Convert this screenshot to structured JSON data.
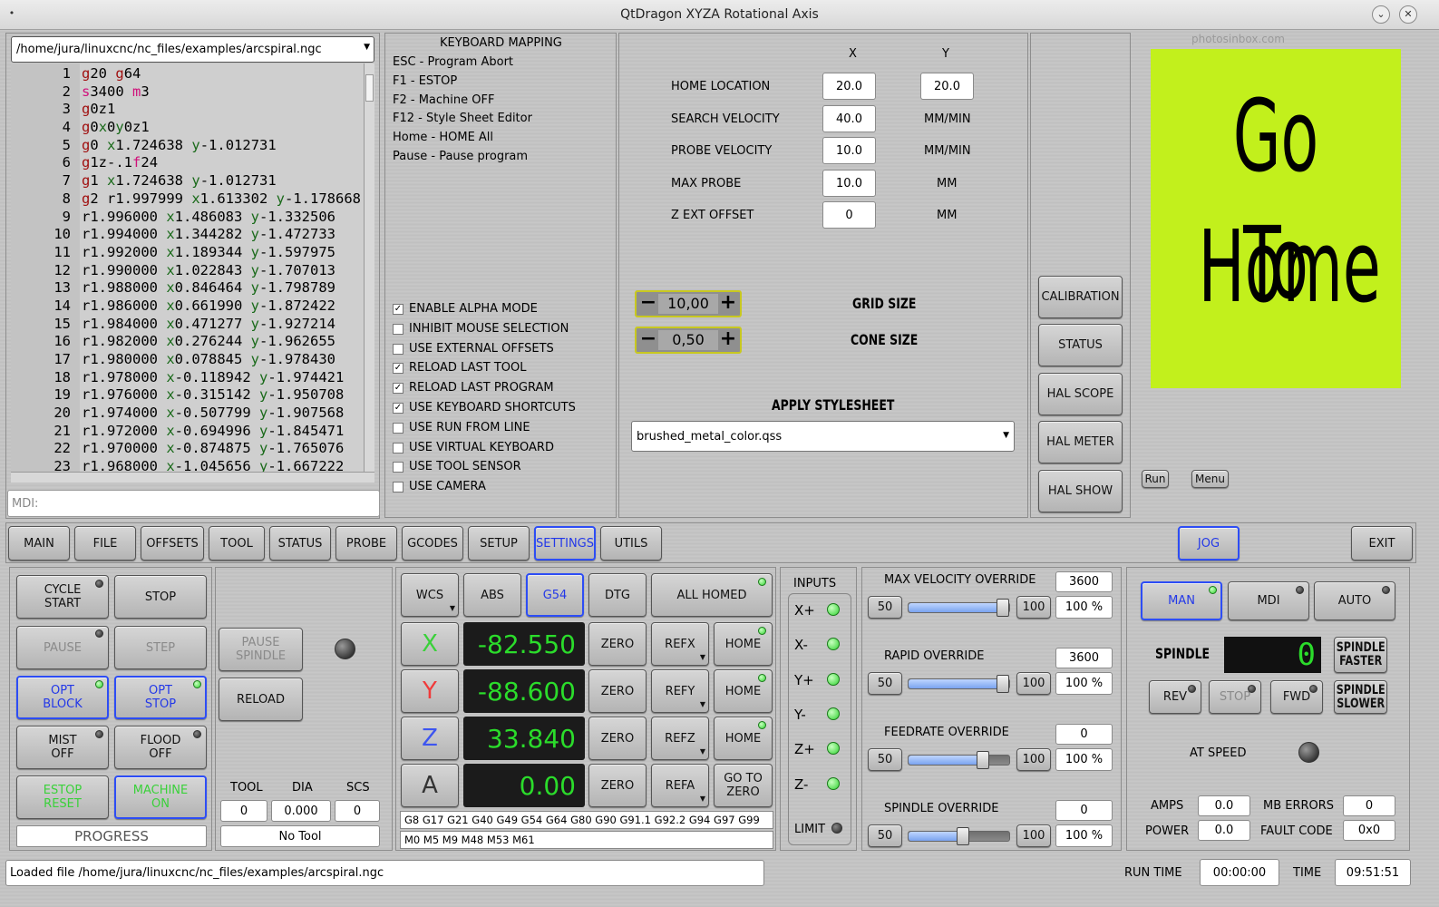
{
  "window": {
    "title": "QtDragon XYZA Rotational Axis"
  },
  "file_path": "/home/jura/linuxcnc/nc_files/examples/arcspiral.ngc",
  "gcode_lines": [
    {
      "n": "1",
      "t": [
        [
          "r",
          "g"
        ],
        [
          "k",
          "20 "
        ],
        [
          "r",
          "g"
        ],
        [
          "k",
          "64"
        ]
      ]
    },
    {
      "n": "2",
      "t": [
        [
          "m",
          "s"
        ],
        [
          "k",
          "3400 "
        ],
        [
          "m",
          "m"
        ],
        [
          "k",
          "3"
        ]
      ]
    },
    {
      "n": "3",
      "t": [
        [
          "r",
          "g"
        ],
        [
          "k",
          "0z1"
        ]
      ]
    },
    {
      "n": "4",
      "t": [
        [
          "r",
          "g"
        ],
        [
          "k",
          "0"
        ],
        [
          "g",
          "x"
        ],
        [
          "k",
          "0"
        ],
        [
          "g",
          "y"
        ],
        [
          "k",
          "0z1"
        ]
      ]
    },
    {
      "n": "5",
      "t": [
        [
          "r",
          "g"
        ],
        [
          "k",
          "0 "
        ],
        [
          "g",
          "x"
        ],
        [
          "k",
          "1.724638 "
        ],
        [
          "g",
          "y"
        ],
        [
          "k",
          "-1.012731"
        ]
      ]
    },
    {
      "n": "6",
      "t": [
        [
          "r",
          "g"
        ],
        [
          "k",
          "1z-.1"
        ],
        [
          "m",
          "f"
        ],
        [
          "k",
          "24"
        ]
      ]
    },
    {
      "n": "7",
      "t": [
        [
          "r",
          "g"
        ],
        [
          "k",
          "1 "
        ],
        [
          "g",
          "x"
        ],
        [
          "k",
          "1.724638 "
        ],
        [
          "g",
          "y"
        ],
        [
          "k",
          "-1.012731"
        ]
      ]
    },
    {
      "n": "8",
      "t": [
        [
          "r",
          "g"
        ],
        [
          "k",
          "2 r1.997999 "
        ],
        [
          "g",
          "x"
        ],
        [
          "k",
          "1.613302 "
        ],
        [
          "g",
          "y"
        ],
        [
          "k",
          "-1.178668"
        ]
      ]
    },
    {
      "n": "9",
      "t": [
        [
          "k",
          "r1.996000 "
        ],
        [
          "g",
          "x"
        ],
        [
          "k",
          "1.486083 "
        ],
        [
          "g",
          "y"
        ],
        [
          "k",
          "-1.332506"
        ]
      ]
    },
    {
      "n": "10",
      "t": [
        [
          "k",
          "r1.994000 "
        ],
        [
          "g",
          "x"
        ],
        [
          "k",
          "1.344282 "
        ],
        [
          "g",
          "y"
        ],
        [
          "k",
          "-1.472733"
        ]
      ]
    },
    {
      "n": "11",
      "t": [
        [
          "k",
          "r1.992000 "
        ],
        [
          "g",
          "x"
        ],
        [
          "k",
          "1.189344 "
        ],
        [
          "g",
          "y"
        ],
        [
          "k",
          "-1.597975"
        ]
      ]
    },
    {
      "n": "12",
      "t": [
        [
          "k",
          "r1.990000 "
        ],
        [
          "g",
          "x"
        ],
        [
          "k",
          "1.022843 "
        ],
        [
          "g",
          "y"
        ],
        [
          "k",
          "-1.707013"
        ]
      ]
    },
    {
      "n": "13",
      "t": [
        [
          "k",
          "r1.988000 "
        ],
        [
          "g",
          "x"
        ],
        [
          "k",
          "0.846464 "
        ],
        [
          "g",
          "y"
        ],
        [
          "k",
          "-1.798789"
        ]
      ]
    },
    {
      "n": "14",
      "t": [
        [
          "k",
          "r1.986000 "
        ],
        [
          "g",
          "x"
        ],
        [
          "k",
          "0.661990 "
        ],
        [
          "g",
          "y"
        ],
        [
          "k",
          "-1.872422"
        ]
      ]
    },
    {
      "n": "15",
      "t": [
        [
          "k",
          "r1.984000 "
        ],
        [
          "g",
          "x"
        ],
        [
          "k",
          "0.471277 "
        ],
        [
          "g",
          "y"
        ],
        [
          "k",
          "-1.927214"
        ]
      ]
    },
    {
      "n": "16",
      "t": [
        [
          "k",
          "r1.982000 "
        ],
        [
          "g",
          "x"
        ],
        [
          "k",
          "0.276244 "
        ],
        [
          "g",
          "y"
        ],
        [
          "k",
          "-1.962655"
        ]
      ]
    },
    {
      "n": "17",
      "t": [
        [
          "k",
          "r1.980000 "
        ],
        [
          "g",
          "x"
        ],
        [
          "k",
          "0.078845 "
        ],
        [
          "g",
          "y"
        ],
        [
          "k",
          "-1.978430"
        ]
      ]
    },
    {
      "n": "18",
      "t": [
        [
          "k",
          "r1.978000 "
        ],
        [
          "g",
          "x"
        ],
        [
          "k",
          "-0.118942 "
        ],
        [
          "g",
          "y"
        ],
        [
          "k",
          "-1.974421"
        ]
      ]
    },
    {
      "n": "19",
      "t": [
        [
          "k",
          "r1.976000 "
        ],
        [
          "g",
          "x"
        ],
        [
          "k",
          "-0.315142 "
        ],
        [
          "g",
          "y"
        ],
        [
          "k",
          "-1.950708"
        ]
      ]
    },
    {
      "n": "20",
      "t": [
        [
          "k",
          "r1.974000 "
        ],
        [
          "g",
          "x"
        ],
        [
          "k",
          "-0.507799 "
        ],
        [
          "g",
          "y"
        ],
        [
          "k",
          "-1.907568"
        ]
      ]
    },
    {
      "n": "21",
      "t": [
        [
          "k",
          "r1.972000 "
        ],
        [
          "g",
          "x"
        ],
        [
          "k",
          "-0.694996 "
        ],
        [
          "g",
          "y"
        ],
        [
          "k",
          "-1.845471"
        ]
      ]
    },
    {
      "n": "22",
      "t": [
        [
          "k",
          "r1.970000 "
        ],
        [
          "g",
          "x"
        ],
        [
          "k",
          "-0.874875 "
        ],
        [
          "g",
          "y"
        ],
        [
          "k",
          "-1.765076"
        ]
      ]
    },
    {
      "n": "23",
      "t": [
        [
          "k",
          "r1.968000 "
        ],
        [
          "g",
          "x"
        ],
        [
          "k",
          "-1.045656 "
        ],
        [
          "g",
          "y"
        ],
        [
          "k",
          "-1.667222"
        ]
      ]
    }
  ],
  "mdi_placeholder": "MDI:",
  "keyboard_mapping": {
    "title": "KEYBOARD MAPPING",
    "items": [
      "ESC - Program Abort",
      "F1 - ESTOP",
      "F2 - Machine OFF",
      "F12 - Style Sheet Editor",
      "Home - HOME All",
      "Pause - Pause program"
    ]
  },
  "options": [
    {
      "label": "ENABLE ALPHA MODE",
      "checked": true
    },
    {
      "label": "INHIBIT MOUSE SELECTION",
      "checked": false
    },
    {
      "label": "USE EXTERNAL OFFSETS",
      "checked": false
    },
    {
      "label": "RELOAD LAST TOOL",
      "checked": true
    },
    {
      "label": "RELOAD LAST PROGRAM",
      "checked": true
    },
    {
      "label": "USE KEYBOARD SHORTCUTS",
      "checked": true
    },
    {
      "label": "USE RUN FROM LINE",
      "checked": false
    },
    {
      "label": "USE VIRTUAL KEYBOARD",
      "checked": false
    },
    {
      "label": "USE TOOL SENSOR",
      "checked": false
    },
    {
      "label": "USE CAMERA",
      "checked": false
    }
  ],
  "probe": {
    "col_x": "X",
    "col_y": "Y",
    "home_label": "HOME LOCATION",
    "home_x": "20.0",
    "home_y": "20.0",
    "search_label": "SEARCH VELOCITY",
    "search_val": "40.0",
    "search_unit": "MM/MIN",
    "probe_label": "PROBE VELOCITY",
    "probe_val": "10.0",
    "probe_unit": "MM/MIN",
    "max_label": "MAX PROBE",
    "max_val": "10.0",
    "max_unit": "MM",
    "zext_label": "Z EXT OFFSET",
    "zext_val": "0",
    "zext_unit": "MM"
  },
  "grid": {
    "value": "10,00",
    "label": "GRID SIZE"
  },
  "cone": {
    "value": "0,50",
    "label": "CONE SIZE"
  },
  "stylesheet": {
    "label": "APPLY STYLESHEET",
    "value": "brushed_metal_color.qss"
  },
  "utility_buttons": [
    "CALIBRATION",
    "STATUS",
    "HAL SCOPE",
    "HAL METER",
    "HAL SHOW"
  ],
  "image": {
    "watermark": "photosinbox.com",
    "line1": "Go To",
    "line2": "Home",
    "bg": "#c2f01c"
  },
  "image_buttons": {
    "run": "Run",
    "menu": "Menu"
  },
  "tabs": [
    "MAIN",
    "FILE",
    "OFFSETS",
    "TOOL",
    "STATUS",
    "PROBE",
    "GCODES",
    "SETUP",
    "SETTINGS",
    "UTILS"
  ],
  "jog": "JOG",
  "exit": "EXIT",
  "control": {
    "cycle_start": "CYCLE\nSTART",
    "stop": "STOP",
    "pause": "PAUSE",
    "step": "STEP",
    "opt_block": "OPT\nBLOCK",
    "opt_stop": "OPT\nSTOP",
    "mist": "MIST\nOFF",
    "flood": "FLOOD\nOFF",
    "estop": "ESTOP\nRESET",
    "machine": "MACHINE\nON",
    "progress": "PROGRESS",
    "pause_spindle": "PAUSE\nSPINDLE",
    "reload": "RELOAD"
  },
  "tool": {
    "tool_label": "TOOL",
    "dia_label": "DIA",
    "scs_label": "SCS",
    "tool": "0",
    "dia": "0.000",
    "scs": "0",
    "name": "No Tool"
  },
  "dro": {
    "wcs": "WCS",
    "abs": "ABS",
    "g54": "G54",
    "dtg": "DTG",
    "all_homed": "ALL HOMED",
    "axes": [
      {
        "name": "X",
        "value": "-82.550",
        "color": "#3ad13a",
        "ref": "REFX",
        "right": "HOME"
      },
      {
        "name": "Y",
        "value": "-88.600",
        "color": "#f03a3a",
        "ref": "REFY",
        "right": "HOME"
      },
      {
        "name": "Z",
        "value": "33.840",
        "color": "#3d55f0",
        "ref": "REFZ",
        "right": "HOME"
      },
      {
        "name": "A",
        "value": "0.00",
        "color": "#333333",
        "ref": "REFA",
        "right": "GO TO\nZERO"
      }
    ],
    "zero": "ZERO",
    "gcodes": "G8 G17 G21 G40 G49 G54 G64 G80 G90 G91.1 G92.2 G94 G97 G99",
    "mcodes": "M0 M5 M9 M48 M53 M61"
  },
  "inputs": {
    "title": "INPUTS",
    "items": [
      "X+",
      "X-",
      "Y+",
      "Y-",
      "Z+",
      "Z-"
    ],
    "limit": "LIMIT"
  },
  "overrides": [
    {
      "label": "MAX VELOCITY OVERRIDE",
      "value": "3600",
      "min": "50",
      "max": "100",
      "percent": "100 %",
      "pos": 1.0
    },
    {
      "label": "RAPID OVERRIDE",
      "value": "3600",
      "min": "50",
      "max": "100",
      "percent": "100 %",
      "pos": 1.0
    },
    {
      "label": "FEEDRATE OVERRIDE",
      "value": "0",
      "min": "50",
      "max": "100",
      "percent": "100 %",
      "pos": 0.8
    },
    {
      "label": "SPINDLE OVERRIDE",
      "value": "0",
      "min": "50",
      "max": "100",
      "percent": "100 %",
      "pos": 0.6
    }
  ],
  "spindle": {
    "man": "MAN",
    "mdi": "MDI",
    "auto": "AUTO",
    "label": "SPINDLE",
    "rpm": "0",
    "faster": "SPINDLE\nFASTER",
    "rev": "REV",
    "stop": "STOP",
    "fwd": "FWD",
    "slower": "SPINDLE\nSLOWER",
    "at_speed": "AT SPEED",
    "amps_label": "AMPS",
    "amps": "0.0",
    "power_label": "POWER",
    "power": "0.0",
    "mb_label": "MB ERRORS",
    "mb": "0",
    "fault_label": "FAULT CODE",
    "fault": "0x0"
  },
  "status": {
    "message": "Loaded file /home/jura/linuxcnc/nc_files/examples/arcspiral.ngc",
    "run_time_label": "RUN TIME",
    "run_time": "00:00:00",
    "time_label": "TIME",
    "time": "09:51:51"
  }
}
